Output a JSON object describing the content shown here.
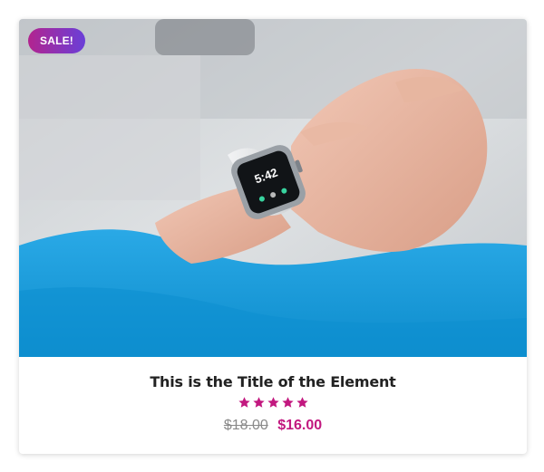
{
  "product": {
    "badge": "SALE!",
    "title": "This is the Title of the Element",
    "rating": 5,
    "rating_max": 5,
    "price_original": "$18.00",
    "price_sale": "$16.00"
  },
  "watch_screen": {
    "time": "5:42"
  },
  "colors": {
    "accent": "#c2187f",
    "badge_gradient_start": "#b2248f",
    "badge_gradient_end": "#6a3fd8",
    "sleeve_blue": "#1aa3e0"
  },
  "icons": {
    "star": "star-icon"
  }
}
